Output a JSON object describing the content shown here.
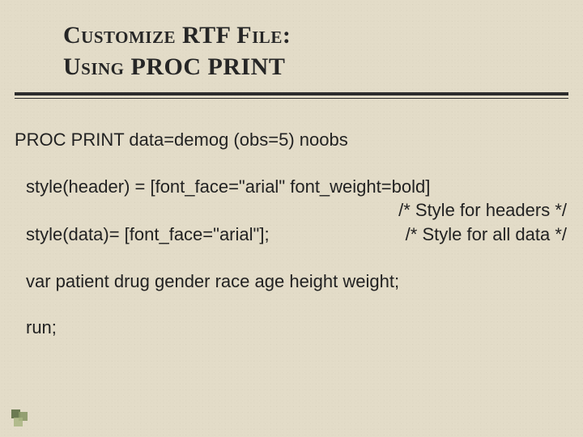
{
  "title": {
    "line1": "Customize RTF File:",
    "line2": "Using PROC PRINT"
  },
  "code": {
    "proc": "PROC PRINT data=demog (obs=5) noobs",
    "styleHeader": "style(header) = [font_face=\"arial\" font_weight=bold]",
    "comment1": "/* Style for headers */",
    "styleData": "style(data)= [font_face=\"arial\"];",
    "comment2": "/* Style for all data */",
    "varStmt": "var patient drug gender race age height weight;",
    "run": "run;"
  }
}
